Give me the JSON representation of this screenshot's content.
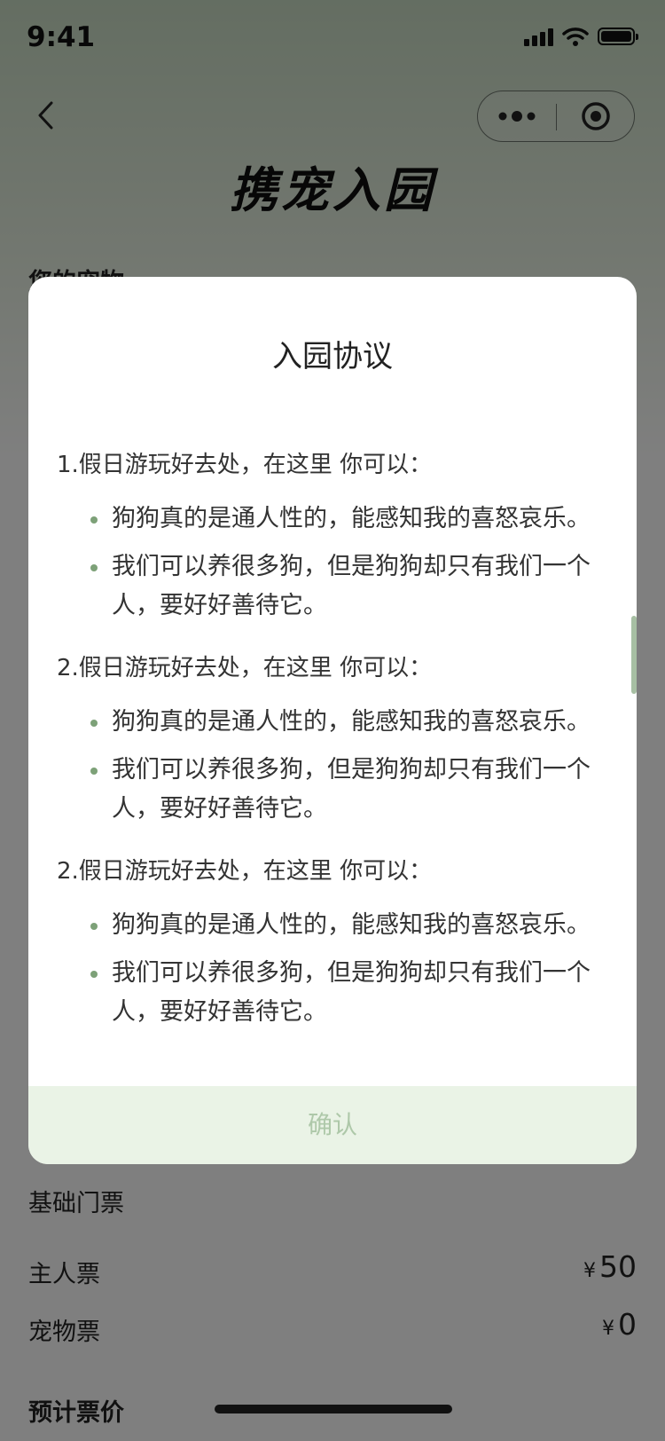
{
  "status_bar": {
    "time": "9:41"
  },
  "nav": {
    "title": "携宠入园"
  },
  "page": {
    "section_peek": "您的宠物",
    "basic_tickets_title": "基础门票",
    "owner_ticket_label": "主人票",
    "owner_ticket_currency": "¥",
    "owner_ticket_price": "50",
    "pet_ticket_label": "宠物票",
    "pet_ticket_currency": "¥",
    "pet_ticket_price": "0",
    "estimate_label": "预计票价"
  },
  "modal": {
    "title": "入园协议",
    "sections": [
      {
        "heading": "1.假日游玩好去处，在这里 你可以：",
        "bullets": [
          "狗狗真的是通人性的，能感知我的喜怒哀乐。",
          "我们可以养很多狗，但是狗狗却只有我们一个人，要好好善待它。"
        ]
      },
      {
        "heading": "2.假日游玩好去处，在这里 你可以：",
        "bullets": [
          "狗狗真的是通人性的，能感知我的喜怒哀乐。",
          "我们可以养很多狗，但是狗狗却只有我们一个人，要好好善待它。"
        ]
      },
      {
        "heading": "2.假日游玩好去处，在这里 你可以：",
        "bullets": [
          "狗狗真的是通人性的，能感知我的喜怒哀乐。",
          "我们可以养很多狗，但是狗狗却只有我们一个人，要好好善待它。"
        ]
      }
    ],
    "confirm_label": "确认"
  },
  "colors": {
    "accent": "#7da178",
    "confirm_bg": "#eaf3e6",
    "confirm_text": "#aec8a9",
    "overlay": "rgba(0,0,0,0.5)"
  },
  "icons": {
    "back": "chevron-left-icon",
    "more": "more-dots-icon",
    "close": "target-circle-icon",
    "signal": "cellular-signal-icon",
    "wifi": "wifi-icon",
    "battery": "battery-icon"
  }
}
